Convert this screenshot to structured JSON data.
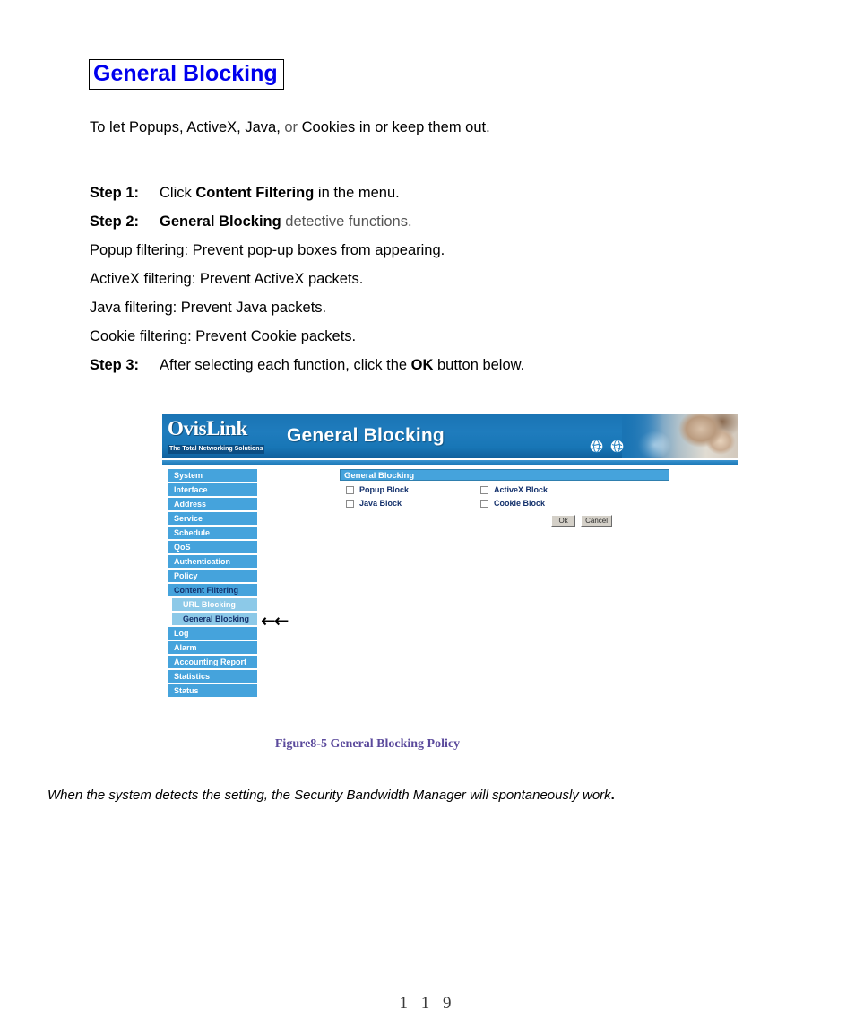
{
  "document": {
    "title": "General Blocking",
    "title_color": "#0000ee",
    "intro_a": "To let Popups, ActiveX, Java,",
    "intro_b": " or ",
    "intro_c": "Cookies in or keep them out.",
    "steps": [
      {
        "label": "Step 1:",
        "text_a": "Click ",
        "bold": "Content Filtering",
        "text_b": " in the menu."
      },
      {
        "label": "Step 2:",
        "text_a": "",
        "bold": "General Blocking",
        "text_b": " detective functions."
      },
      {
        "label": "",
        "plain": "Popup filtering: Prevent pop-up boxes from appearing."
      },
      {
        "label": "",
        "plain": "ActiveX filtering: Prevent ActiveX    packets."
      },
      {
        "label": "",
        "plain": "Java filtering: Prevent Java packets."
      },
      {
        "label": "",
        "plain": "Cookie filtering: Prevent Cookie packets."
      },
      {
        "label": "Step 3:",
        "text_a": "After selecting each function, click the ",
        "bold": "OK",
        "text_b": " button below."
      }
    ],
    "figure_caption": "Figure8-5 General Blocking Policy",
    "footer_note": "When the system detects the setting, the Security Bandwidth Manager will spontaneously work",
    "footer_note_dot": ".",
    "page_number": "1 1 9"
  },
  "ui": {
    "banner": {
      "logo_word": "OvisLink",
      "logo_tagline": "The Total Networking Solutions",
      "page_heading": "General Blocking",
      "globe_icon_1": "globe-icon",
      "globe_icon_2": "globe-icon",
      "accent": "#1a74b4"
    },
    "sidebar": {
      "items": [
        {
          "label": "System",
          "state": "normal"
        },
        {
          "label": "Interface",
          "state": "normal"
        },
        {
          "label": "Address",
          "state": "normal"
        },
        {
          "label": "Service",
          "state": "normal"
        },
        {
          "label": "Schedule",
          "state": "normal"
        },
        {
          "label": "QoS",
          "state": "normal"
        },
        {
          "label": "Authentication",
          "state": "normal"
        },
        {
          "label": "Policy",
          "state": "normal"
        },
        {
          "label": "Content Filtering",
          "state": "active"
        }
      ],
      "sub_items": [
        {
          "label": "URL Blocking",
          "state": "normal"
        },
        {
          "label": "General Blocking",
          "state": "current"
        }
      ],
      "items_after": [
        {
          "label": "Log",
          "state": "normal"
        },
        {
          "label": "Alarm",
          "state": "normal"
        },
        {
          "label": "Accounting Report",
          "state": "normal"
        },
        {
          "label": "Statistics",
          "state": "normal"
        },
        {
          "label": "Status",
          "state": "normal"
        }
      ],
      "pointer_arrows": "←←",
      "item_bg": "#45a3dc",
      "sub_item_bg": "#8cc9e8",
      "active_text": "#13306b"
    },
    "panel": {
      "header": "General Blocking",
      "checkboxes": [
        {
          "label": "Popup Block",
          "checked": false
        },
        {
          "label": "ActiveX Block",
          "checked": false
        },
        {
          "label": "Java Block",
          "checked": false
        },
        {
          "label": "Cookie Block",
          "checked": false
        }
      ],
      "ok_button": "Ok",
      "cancel_button": "Cancel"
    }
  }
}
